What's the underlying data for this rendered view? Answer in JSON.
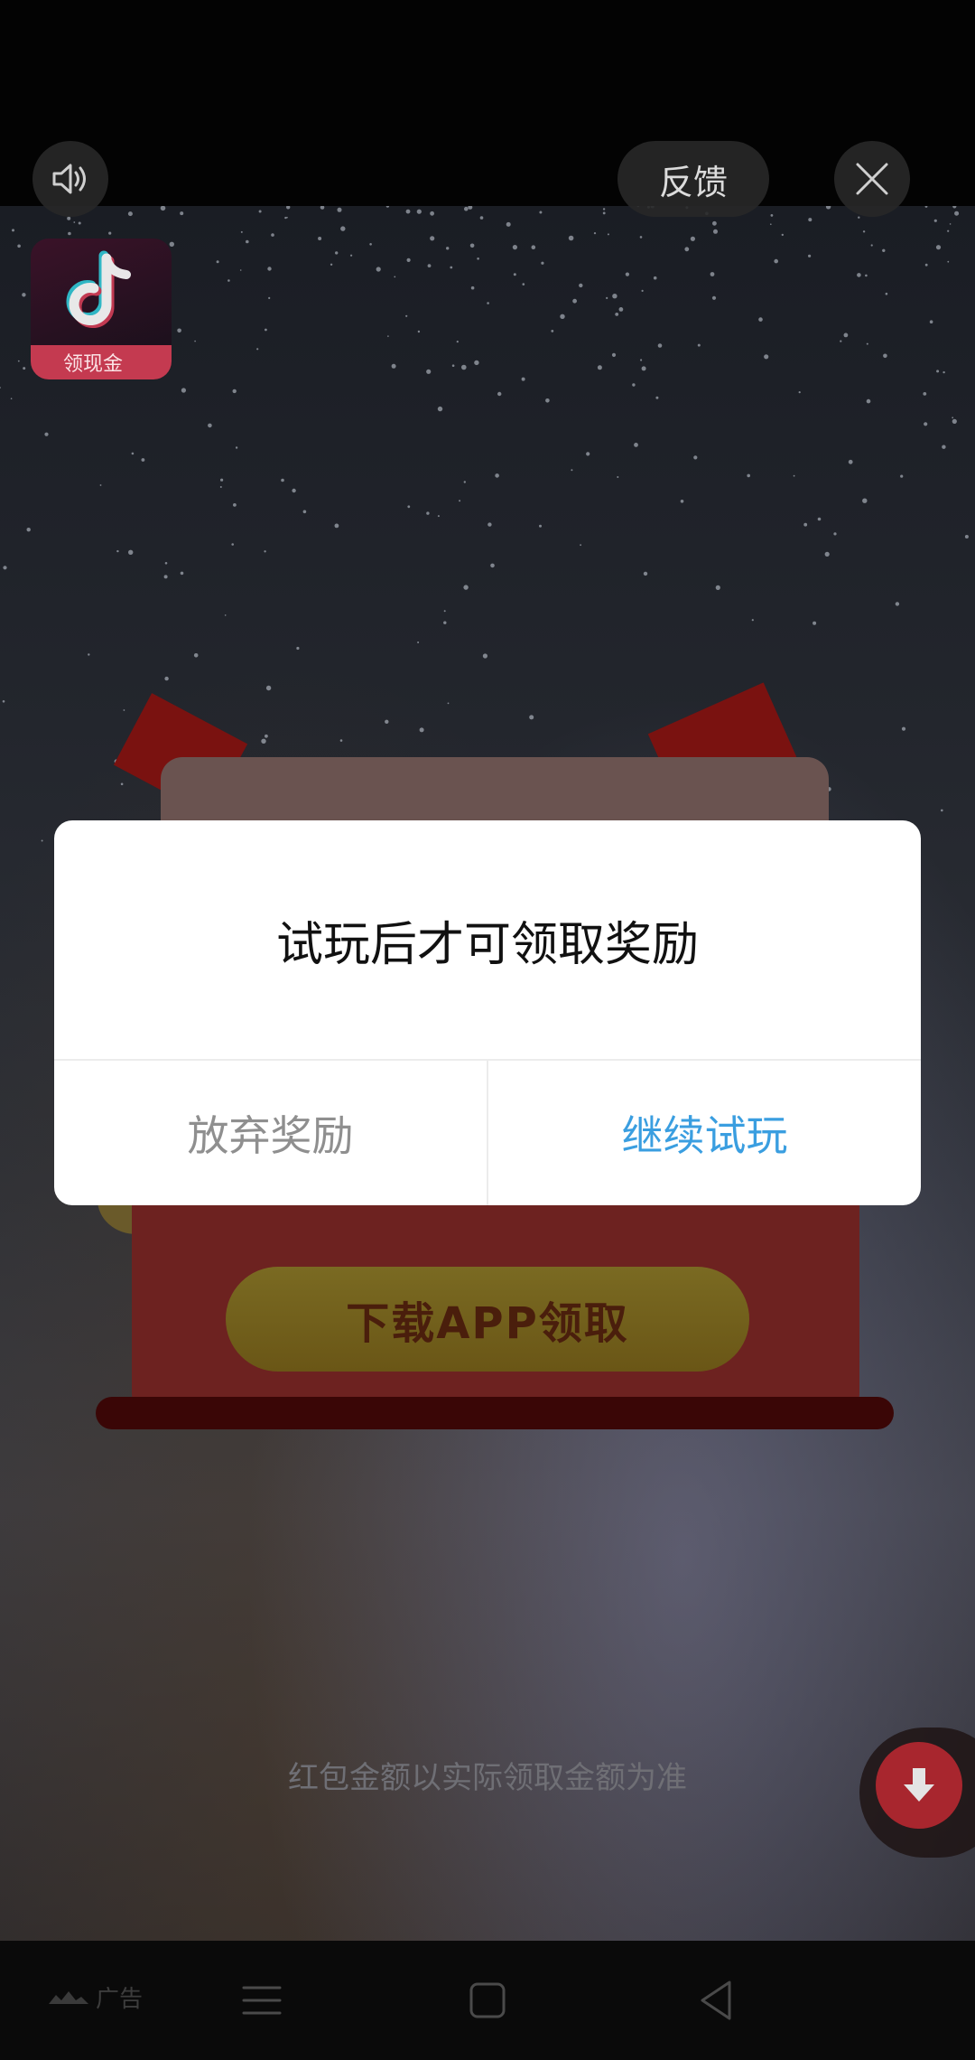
{
  "header": {
    "feedback_label": "反馈",
    "sound_icon": "speaker-icon",
    "close_icon": "close-icon"
  },
  "app": {
    "badge_text": "领现金",
    "icon": "tiktok-note-icon"
  },
  "ad": {
    "download_button_label": "下载APP领取",
    "disclaimer": "红包金额以实际领取金额为准"
  },
  "dialog": {
    "title": "试玩后才可领取奖励",
    "abandon_label": "放弃奖励",
    "continue_label": "继续试玩",
    "continue_color": "#3a9ee0"
  },
  "navbar": {
    "ad_tag": "广告"
  }
}
